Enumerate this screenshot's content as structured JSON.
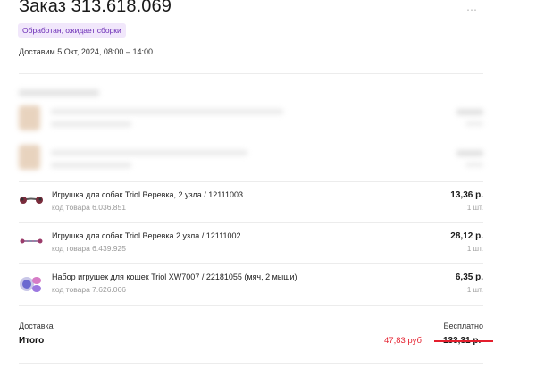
{
  "order": {
    "title": "Заказ 313.618.069",
    "status_badge": "Обработан, ожидает сборки",
    "delivery_date": "Доставим 5 Окт, 2024, 08:00 – 14:00",
    "more_icon": "more-dots-icon"
  },
  "items": [
    {
      "name": "Игрушка для собак Triol Веревка, 2 узла / 12111003",
      "code": "код товара 6.036.851",
      "price": "13,36 р.",
      "qty": "1 шт.",
      "icon": "rope-toy-thumbnail"
    },
    {
      "name": "Игрушка для собак Triol Веревка 2 узла / 12111002",
      "code": "код товара 6.439.925",
      "price": "28,12 р.",
      "qty": "1 шт.",
      "icon": "rope-toy-thumbnail"
    },
    {
      "name": "Набор игрушек для кошек Triol XW7007 / 22181055 (мяч, 2 мыши)",
      "code": "код товара 7.626.066",
      "price": "6,35 р.",
      "qty": "1 шт.",
      "icon": "cat-toys-thumbnail"
    }
  ],
  "summary": {
    "delivery_label": "Доставка",
    "delivery_value": "Бесплатно",
    "total_label": "Итого",
    "total_new": "47,83 руб",
    "total_old": "133,31 р."
  },
  "colors": {
    "badge_bg": "#f1e7fb",
    "badge_text": "#6a2bb5",
    "discount_red": "#e41f2d"
  }
}
